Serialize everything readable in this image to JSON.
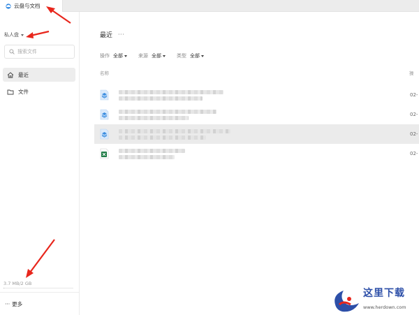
{
  "tab": {
    "title": "云盘与文档"
  },
  "sidebar": {
    "space_label": "私人盘",
    "search_placeholder": "搜索文件",
    "nav": [
      {
        "label": "最近",
        "icon": "home-icon",
        "active": true
      },
      {
        "label": "文件",
        "icon": "folder-icon",
        "active": false
      }
    ],
    "storage": "3.7 MB/2 GB",
    "storage_fraction": 0.0018,
    "more_label": "更多",
    "more_icon": "ellipsis-icon"
  },
  "main": {
    "title": "最近",
    "title_more": "···",
    "filters": [
      {
        "label": "操作",
        "value": "全部"
      },
      {
        "label": "来源",
        "value": "全部"
      },
      {
        "label": "类型",
        "value": "全部"
      }
    ],
    "columns": {
      "name": "名称",
      "operation": "操"
    },
    "files": [
      {
        "icon": "doc-icon",
        "date": "02-",
        "selected": false
      },
      {
        "icon": "doc-icon",
        "date": "02-",
        "selected": false
      },
      {
        "icon": "doc-icon",
        "date": "02-",
        "selected": true
      },
      {
        "icon": "excel-icon",
        "date": "02-",
        "selected": false
      }
    ]
  },
  "colors": {
    "doc_icon": "#3a8de0",
    "excel_icon": "#1d7a44",
    "annotation_arrow": "#e8261c",
    "selected_row": "#ebebeb"
  },
  "watermark": {
    "title": "这里下载",
    "url": "www.herdown.com"
  }
}
